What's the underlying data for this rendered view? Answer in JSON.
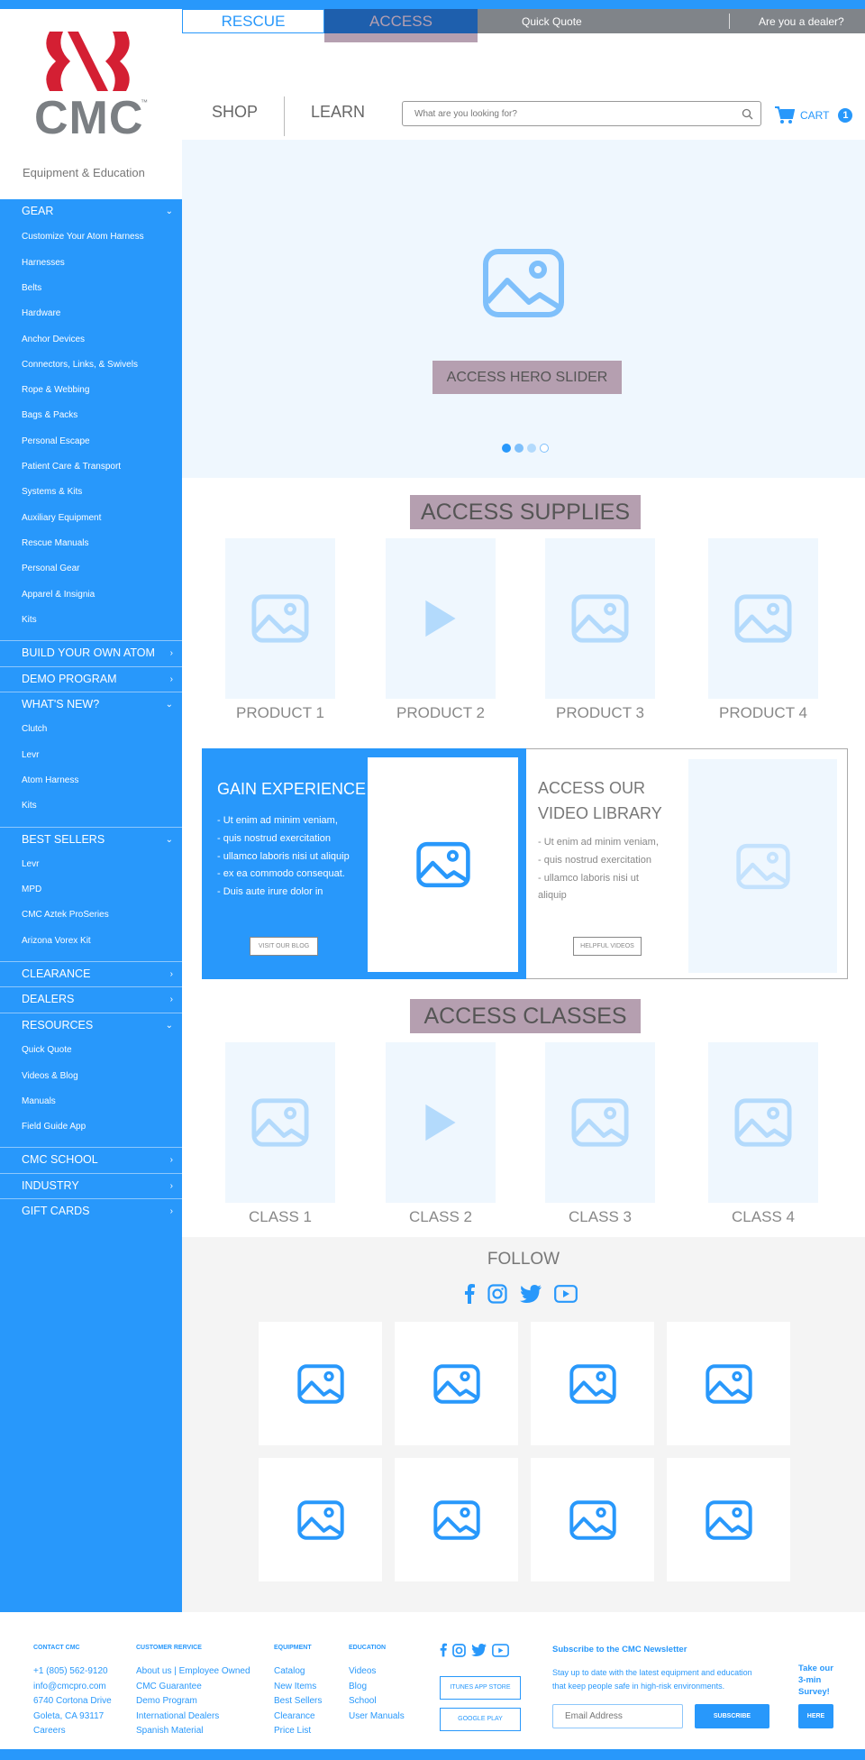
{
  "colors": {
    "accent": "#2898fb",
    "mauve": "#b59fb0",
    "logo_red": "#d41f33",
    "logo_gray": "#7b7f83"
  },
  "header": {
    "tabs": [
      {
        "label": "RESCUE",
        "active": false
      },
      {
        "label": "ACCESS",
        "active": true
      }
    ],
    "utility": {
      "quick_quote": "Quick Quote",
      "dealer": "Are you a dealer?"
    },
    "logo_text": "CMC",
    "logo_tm": "™",
    "tagline": "Equipment & Education",
    "nav": {
      "shop": "SHOP",
      "learn": "LEARN"
    },
    "search": {
      "placeholder": "What are you looking for?",
      "value": "",
      "icon": "search-icon"
    },
    "cart": {
      "label": "CART",
      "count": "1",
      "icon": "cart-icon"
    }
  },
  "sidebar": {
    "sections": [
      {
        "label": "GEAR",
        "chevron": "⌄",
        "items": [
          "Customize Your Atom Harness",
          "Harnesses",
          "Belts",
          "Hardware",
          "Anchor Devices",
          "Connectors, Links, & Swivels",
          "Rope & Webbing",
          "Bags & Packs",
          "Personal Escape",
          "Patient Care & Transport",
          "Systems & Kits",
          "Auxiliary Equipment",
          "Rescue Manuals",
          "Personal Gear",
          "Apparel & Insignia",
          "Kits"
        ]
      },
      {
        "label": "BUILD YOUR OWN ATOM",
        "chevron": "›",
        "items": []
      },
      {
        "label": "DEMO PROGRAM",
        "chevron": "›",
        "items": []
      },
      {
        "label": "WHAT'S NEW?",
        "chevron": "⌄",
        "items": [
          "Clutch",
          "Levr",
          "Atom Harness",
          "Kits"
        ]
      },
      {
        "label": "BEST SELLERS",
        "chevron": "⌄",
        "items": [
          "Levr",
          "MPD",
          "CMC Aztek ProSeries",
          "Arizona Vorex Kit"
        ]
      },
      {
        "label": "CLEARANCE",
        "chevron": "›",
        "items": []
      },
      {
        "label": "DEALERS",
        "chevron": "›",
        "items": []
      },
      {
        "label": "RESOURCES",
        "chevron": "⌄",
        "items": [
          "Quick Quote",
          "Videos & Blog",
          "Manuals",
          "Field Guide App"
        ]
      },
      {
        "label": "CMC SCHOOL",
        "chevron": "›",
        "items": []
      },
      {
        "label": "INDUSTRY",
        "chevron": "›",
        "items": []
      },
      {
        "label": "GIFT CARDS",
        "chevron": "›",
        "items": []
      }
    ]
  },
  "hero": {
    "label": "ACCESS HERO SLIDER",
    "slides": 4,
    "active_slide": 1
  },
  "supplies": {
    "title": "ACCESS SUPPLIES",
    "items": [
      {
        "label": "PRODUCT 1",
        "media": "image"
      },
      {
        "label": "PRODUCT 2",
        "media": "video"
      },
      {
        "label": "PRODUCT 3",
        "media": "image"
      },
      {
        "label": "PRODUCT 4",
        "media": "image"
      }
    ]
  },
  "promo": {
    "left": {
      "title": "GAIN EXPERIENCE",
      "bullets": [
        "- Ut enim ad minim veniam,",
        "- quis nostrud exercitation",
        "- ullamco laboris nisi ut aliquip",
        "- ex ea commodo consequat.",
        "- Duis aute irure dolor in"
      ],
      "button": "VISIT OUR BLOG"
    },
    "right": {
      "title_line1": "ACCESS OUR",
      "title_line2": "VIDEO LIBRARY",
      "bullets": [
        "- Ut enim ad minim veniam,",
        "- quis nostrud exercitation",
        "- ullamco laboris nisi ut",
        "aliquip"
      ],
      "button": "HELPFUL VIDEOS"
    }
  },
  "classes": {
    "title": "ACCESS CLASSES",
    "items": [
      {
        "label": "CLASS 1",
        "media": "image"
      },
      {
        "label": "CLASS 2",
        "media": "video"
      },
      {
        "label": "CLASS 3",
        "media": "image"
      },
      {
        "label": "CLASS 4",
        "media": "image"
      }
    ]
  },
  "follow": {
    "title": "FOLLOW",
    "social": [
      "facebook-icon",
      "instagram-icon",
      "twitter-icon",
      "youtube-icon"
    ],
    "tiles": 8
  },
  "footer": {
    "contact": {
      "heading": "CONTACT CMC",
      "lines": [
        "+1 (805) 562-9120",
        "info@cmcpro.com",
        "6740 Cortona Drive",
        "Goleta, CA 93117",
        "Careers"
      ]
    },
    "customer": {
      "heading": "CUSTOMER RERVICE",
      "lines": [
        "About us | Employee Owned",
        "CMC Guarantee",
        "Demo Program",
        "International Dealers",
        "Spanish Material"
      ]
    },
    "equipment": {
      "heading": "EQUIPMENT",
      "lines": [
        "Catalog",
        "New Items",
        "Best Sellers",
        "Clearance",
        "Price List"
      ]
    },
    "education": {
      "heading": "EDUCATION",
      "lines": [
        "Videos",
        "Blog",
        "School",
        "User Manuals"
      ]
    },
    "apps": {
      "itunes": "ITUNES APP STORE",
      "google": "GOOGLE PLAY"
    },
    "newsletter": {
      "heading": "Subscribe to the CMC Newsletter",
      "text1": "Stay up to date with the latest equipment and education",
      "text2": "that keep people safe in high-risk environments.",
      "placeholder": "Email Address",
      "button": "SUBSCRIBE"
    },
    "survey": {
      "line1": "Take our",
      "line2": "3-min",
      "line3": "Survey!",
      "button": "HERE"
    }
  }
}
